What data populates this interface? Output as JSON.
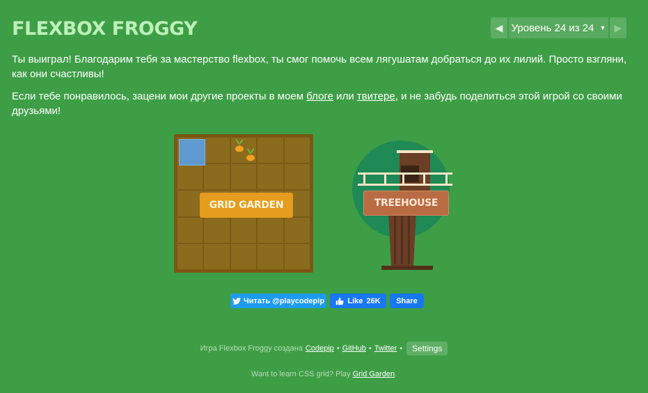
{
  "header": {
    "logo": "FLEXBOX FROGGY"
  },
  "level_nav": {
    "prev": "◀",
    "label": "Уровень 24 из 24",
    "caret": "▼",
    "next": "▶"
  },
  "message": {
    "para1": "Ты выиграл! Благодарим тебя за мастерство flexbox, ты смог помочь всем лягушатам добраться до их лилий. Просто взгляни, как они счастливы!",
    "para2_start": "Если тебе понравилось, зацени мои другие проекты в моем ",
    "blog_link": "блоге",
    "para2_mid": " или ",
    "twitter_link": "твитере",
    "para2_end": ", и не забудь поделиться этой игрой со своими друзьями!"
  },
  "projects": {
    "grid_garden": "GRID GARDEN",
    "treehouse": "TREEHOUSE"
  },
  "social": {
    "twitter_follow": "Читать @playcodepip",
    "fb_like": "Like",
    "fb_like_count": "26K",
    "fb_share": "Share"
  },
  "footer": {
    "credit_prefix": "Игра Flexbox Froggy создана",
    "codepip": "Codepip",
    "github": "GitHub",
    "twitter": "Twitter",
    "sep": "•",
    "settings": "Settings",
    "promo_prefix": "Want to learn CSS grid? Play",
    "grid_garden": "Grid Garden",
    "promo_suffix": "."
  },
  "colors": {
    "background": "#3e9e46",
    "logo": "#bdf0b8",
    "grid_garden_label": "#e59c1f",
    "treehouse_label": "#b96b44",
    "twitter": "#1d9bf0",
    "facebook": "#1877f2"
  }
}
